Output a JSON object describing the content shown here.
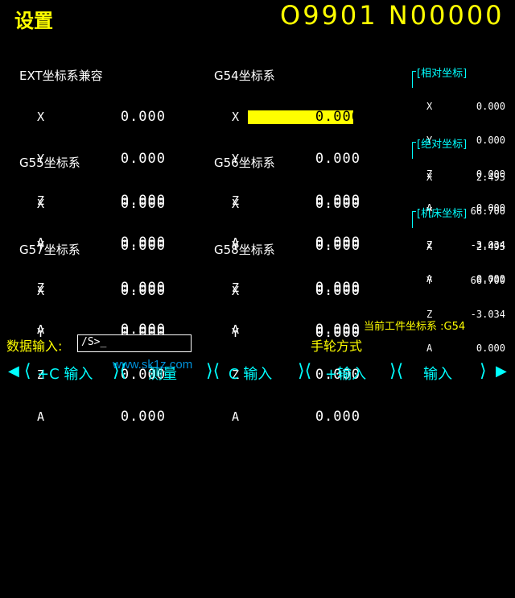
{
  "header": {
    "title": "设置",
    "program": "O9901 N00000"
  },
  "groups": [
    {
      "name": "EXT坐标系兼容",
      "rows": [
        {
          "axis": "X",
          "value": "0.000"
        },
        {
          "axis": "Y",
          "value": "0.000"
        },
        {
          "axis": "Z",
          "value": "0.000"
        },
        {
          "axis": "A",
          "value": "0.000"
        }
      ]
    },
    {
      "name": "G54坐标系",
      "rows": [
        {
          "axis": "X",
          "value": "0.000"
        },
        {
          "axis": "Y",
          "value": "0.000"
        },
        {
          "axis": "Z",
          "value": "0.000"
        },
        {
          "axis": "A",
          "value": "0.000"
        }
      ]
    },
    {
      "name": "G55坐标系",
      "rows": [
        {
          "axis": "X",
          "value": "0.000"
        },
        {
          "axis": "Y",
          "value": "0.000"
        },
        {
          "axis": "Z",
          "value": "0.000"
        },
        {
          "axis": "A",
          "value": "0.000"
        }
      ]
    },
    {
      "name": "G56坐标系",
      "rows": [
        {
          "axis": "X",
          "value": "0.000"
        },
        {
          "axis": "Y",
          "value": "0.000"
        },
        {
          "axis": "Z",
          "value": "0.000"
        },
        {
          "axis": "A",
          "value": "0.000"
        }
      ]
    },
    {
      "name": "G57坐标系",
      "rows": [
        {
          "axis": "X",
          "value": "0.000"
        },
        {
          "axis": "Y",
          "value": "0.000"
        },
        {
          "axis": "Z",
          "value": "0.000"
        },
        {
          "axis": "A",
          "value": "0.000"
        }
      ]
    },
    {
      "name": "G58坐标系",
      "rows": [
        {
          "axis": "X",
          "value": "0.000"
        },
        {
          "axis": "Y",
          "value": "0.000"
        },
        {
          "axis": "Z",
          "value": "0.000"
        },
        {
          "axis": "A",
          "value": "0.000"
        }
      ]
    }
  ],
  "selected": {
    "group": "G54坐标系",
    "axis": "X"
  },
  "side": [
    {
      "title": "[相对坐标]",
      "rows": [
        {
          "axis": "X",
          "value": "0.000"
        },
        {
          "axis": "Y",
          "value": "0.000"
        },
        {
          "axis": "Z",
          "value": "0.000"
        },
        {
          "axis": "A",
          "value": "0.000"
        }
      ]
    },
    {
      "title": "[绝对坐标]",
      "rows": [
        {
          "axis": "X",
          "value": "2.495"
        },
        {
          "axis": "Y",
          "value": "66.700"
        },
        {
          "axis": "Z",
          "value": "-3.034"
        },
        {
          "axis": "A",
          "value": "0.000"
        }
      ]
    },
    {
      "title": "[机床坐标]",
      "rows": [
        {
          "axis": "X",
          "value": "2.495"
        },
        {
          "axis": "Y",
          "value": "66.700"
        },
        {
          "axis": "Z",
          "value": "-3.034"
        },
        {
          "axis": "A",
          "value": "0.000"
        }
      ]
    }
  ],
  "status": {
    "work_coord_label": "当前工件坐标系 :G54",
    "mode": "手轮方式"
  },
  "input": {
    "label": "数据输入:",
    "value": "/S>_"
  },
  "softkeys": [
    "+C 输入",
    "测量",
    "C 输入",
    "+输入",
    "输入"
  ],
  "colors": {
    "accent": "#ffff00",
    "cyan": "#00ffff",
    "background": "#000000"
  },
  "watermark": "www.sk1z.com"
}
